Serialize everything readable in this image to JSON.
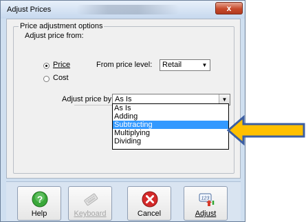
{
  "window": {
    "title": "Adjust Prices",
    "close_label": "x"
  },
  "group": {
    "legend": "Price adjustment options",
    "adjust_from_label": "Adjust price from:",
    "radio_price": "Price",
    "radio_cost": "Cost",
    "selected_source": "Price",
    "from_level_label": "From price level:",
    "price_level_value": "Retail",
    "adjust_by_label": "Adjust price by:",
    "adjust_by_value": "As Is",
    "adjust_by_options": [
      "As Is",
      "Adding",
      "Subtracting",
      "Multiplying",
      "Dividing"
    ],
    "highlighted_option": "Subtracting"
  },
  "toolbar": {
    "help": "Help",
    "keyboard": "Keyboard",
    "cancel": "Cancel",
    "adjust": "Adjust"
  },
  "colors": {
    "selection": "#3399ff",
    "arrow_fill": "#ffc000",
    "arrow_outline": "#3b5ea3"
  }
}
